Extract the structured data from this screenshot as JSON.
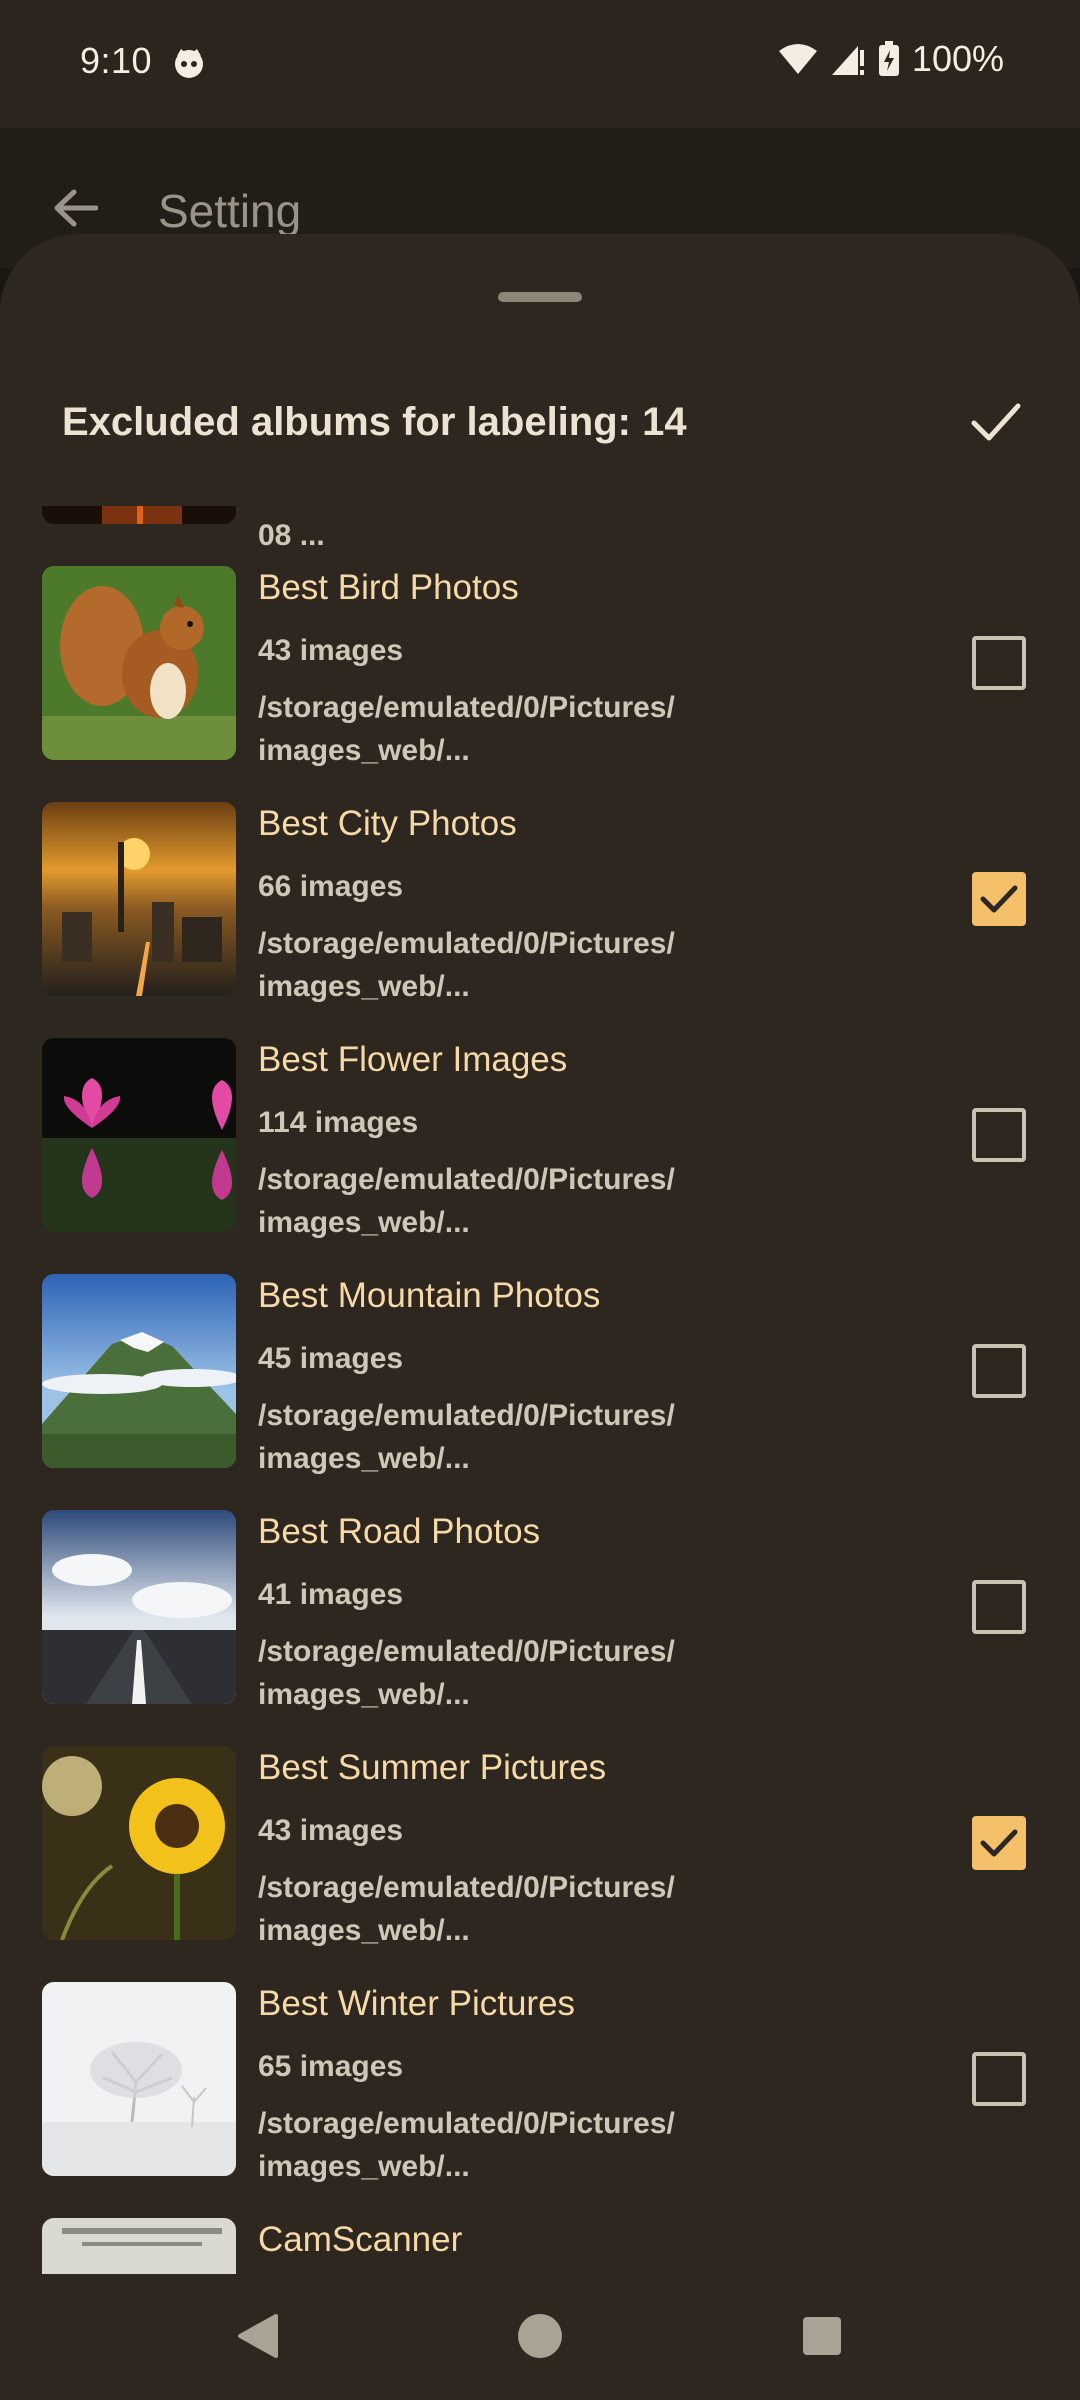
{
  "status_bar": {
    "time": "9:10",
    "battery": "100%"
  },
  "app_bar": {
    "title": "Setting"
  },
  "sheet": {
    "title": "Excluded albums for labeling: 14",
    "partial_top_text": "08 ...",
    "partial_bottom_name": "CamScanner"
  },
  "albums": [
    {
      "name": "Best Bird Photos",
      "count": "43 images",
      "path": "/storage/emulated/0/Pictures/\nimages_web/...",
      "checked": false,
      "thumb": "squirrel"
    },
    {
      "name": "Best City Photos",
      "count": "66 images",
      "path": "/storage/emulated/0/Pictures/\nimages_web/...",
      "checked": true,
      "thumb": "city-sunset"
    },
    {
      "name": "Best Flower Images",
      "count": "114 images",
      "path": "/storage/emulated/0/Pictures/\nimages_web/...",
      "checked": false,
      "thumb": "lotus"
    },
    {
      "name": "Best Mountain Photos",
      "count": "45 images",
      "path": "/storage/emulated/0/Pictures/\nimages_web/...",
      "checked": false,
      "thumb": "mountain"
    },
    {
      "name": "Best Road Photos",
      "count": "41 images",
      "path": "/storage/emulated/0/Pictures/\nimages_web/...",
      "checked": false,
      "thumb": "road"
    },
    {
      "name": "Best Summer Pictures",
      "count": "43 images",
      "path": "/storage/emulated/0/Pictures/\nimages_web/...",
      "checked": true,
      "thumb": "sunflower"
    },
    {
      "name": "Best Winter Pictures",
      "count": "65 images",
      "path": "/storage/emulated/0/Pictures/\nimages_web/...",
      "checked": false,
      "thumb": "snow-tree"
    }
  ],
  "colors": {
    "accent": "#f4c06a",
    "sheet_background": "#2e271f",
    "album_name": "#f6d9a8",
    "secondary_text": "#cfc7b7"
  }
}
